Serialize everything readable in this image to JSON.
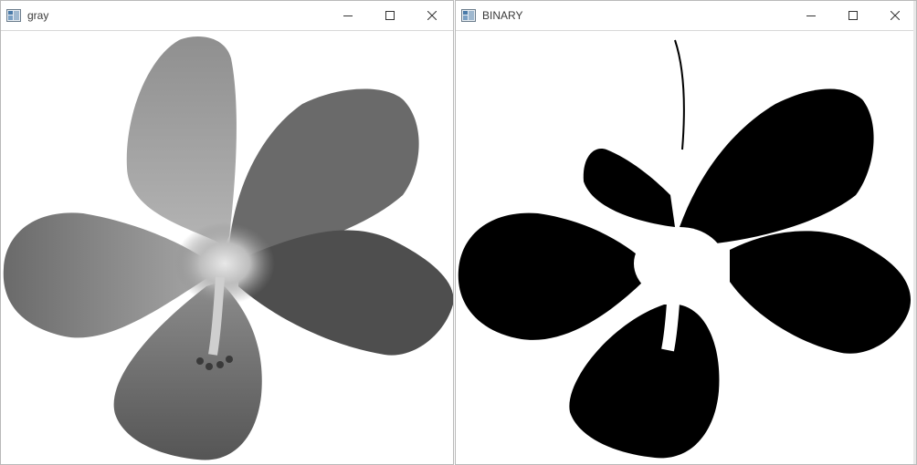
{
  "windows": {
    "gray": {
      "title": "gray",
      "icon": "opencv-window-icon",
      "controls": {
        "minimize": "minimize-icon",
        "maximize": "maximize-icon",
        "close": "close-icon"
      }
    },
    "binary": {
      "title": "BINARY",
      "icon": "opencv-window-icon",
      "controls": {
        "minimize": "minimize-icon",
        "maximize": "maximize-icon",
        "close": "close-icon"
      }
    }
  },
  "colors": {
    "titlebar_bg": "#ffffff",
    "title_text": "#3a3a3a",
    "petal_gray_light": "#8a8a8a",
    "petal_gray_dark": "#4e4e4e",
    "binary_black": "#000000",
    "binary_white": "#ffffff"
  }
}
